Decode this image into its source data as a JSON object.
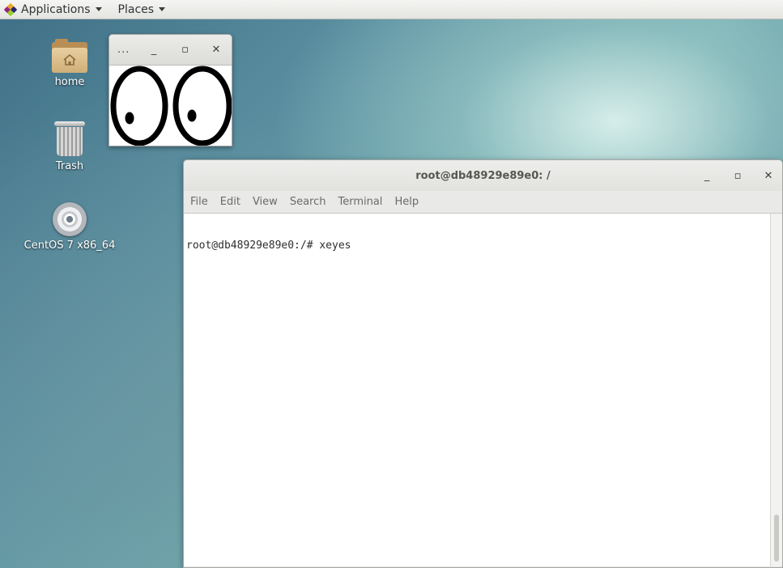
{
  "top_panel": {
    "applications_label": "Applications",
    "places_label": "Places"
  },
  "desktop": {
    "icons": [
      {
        "label": "home",
        "icon": "folder-home-icon"
      },
      {
        "label": "Trash",
        "icon": "trash-icon"
      },
      {
        "label": "CentOS 7 x86_64",
        "icon": "disc-icon"
      }
    ]
  },
  "xeyes_window": {
    "title": "...",
    "minimize": "_",
    "maximize": "▫",
    "close": "✕"
  },
  "terminal": {
    "title": "root@db48929e89e0: /",
    "controls": {
      "minimize": "_",
      "maximize": "▫",
      "close": "✕"
    },
    "menu": [
      "File",
      "Edit",
      "View",
      "Search",
      "Terminal",
      "Help"
    ],
    "lines": [
      "root@db48929e89e0:/# xeyes"
    ]
  },
  "colors": {
    "panel_bg": "#e4e4e1",
    "terminal_bg": "#ffffff",
    "terminal_fg": "#2e2e2e",
    "desktop_accent": "#6fa8ad"
  }
}
